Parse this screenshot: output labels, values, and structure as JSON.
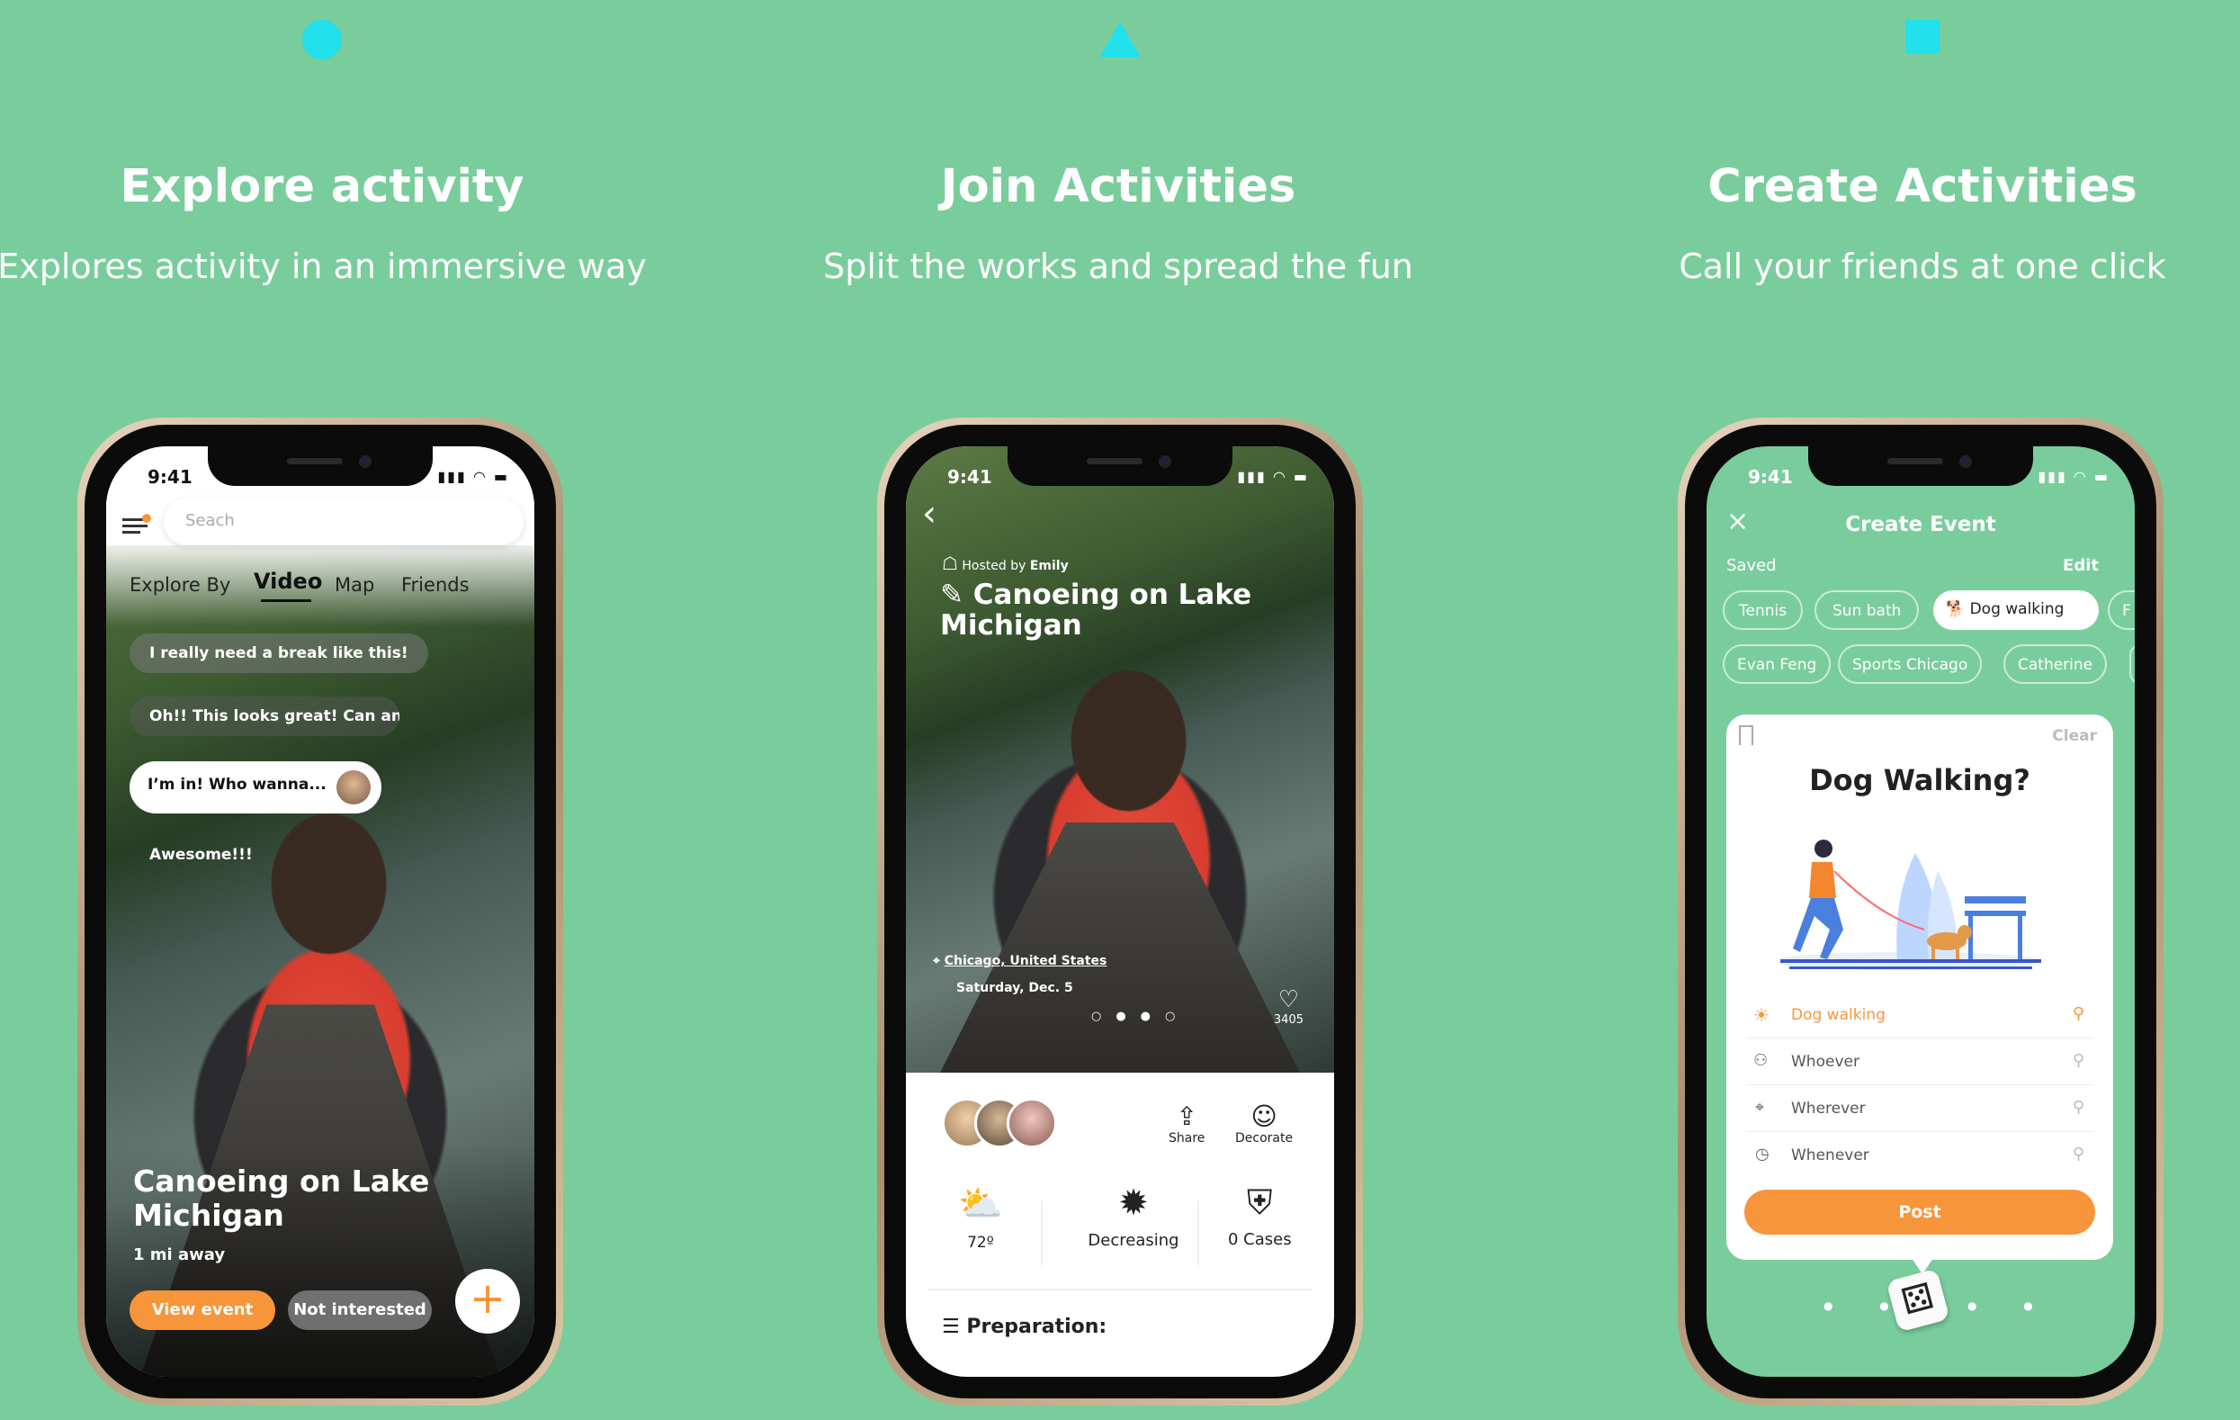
{
  "columns": [
    {
      "title": "Explore activity",
      "subtitle": "Explores activity in an immersive way"
    },
    {
      "title": "Join Activities",
      "subtitle": "Split the works and spread the fun"
    },
    {
      "title": "Create Activities",
      "subtitle": "Call your friends at one click"
    }
  ],
  "status_time": "9:41",
  "phone1": {
    "search_placeholder": "Seach",
    "explore_by": "Explore By",
    "tabs": [
      "Video",
      "Map",
      "Friends"
    ],
    "comments": [
      "I really need a break like this!",
      "Oh!! This looks great! Can anyone...",
      "I’m in! Who wanna...",
      "Awesome!!!"
    ],
    "title_line1": "Canoeing on Lake",
    "title_line2": "Michigan",
    "distance": "1 mi away",
    "view_event": "View event",
    "not_interested": "Not interested",
    "add": "+"
  },
  "phone2": {
    "hosted_by": "Hosted by",
    "host": "Emily",
    "title_line1": "Canoeing on Lake",
    "title_line2": "Michigan",
    "location": "Chicago, United States",
    "date": "Saturday, Dec. 5",
    "likes": "3405",
    "share": "Share",
    "decorate": "Decorate",
    "weather": "72º",
    "trend": "Decreasing",
    "cases": "0 Cases",
    "preparation": "Preparation:"
  },
  "phone3": {
    "header": "Create Event",
    "saved": "Saved",
    "edit": "Edit",
    "chips_row1": [
      "Tennis",
      "Sun bath",
      "Dog walking",
      "F"
    ],
    "chips_row2": [
      "Evan Feng",
      "Sports Chicago",
      "Catherine"
    ],
    "clear": "Clear",
    "card_title": "Dog Walking?",
    "fields": [
      {
        "label": "Dog walking",
        "icon": "sun-icon"
      },
      {
        "label": "Whoever",
        "icon": "people-icon"
      },
      {
        "label": "Wherever",
        "icon": "location-pin-icon"
      },
      {
        "label": "Whenever",
        "icon": "clock-icon"
      }
    ],
    "post": "Post"
  },
  "colors": {
    "background": "#79cd9c",
    "accent": "#f7953b",
    "cyan": "#22e0ec"
  }
}
